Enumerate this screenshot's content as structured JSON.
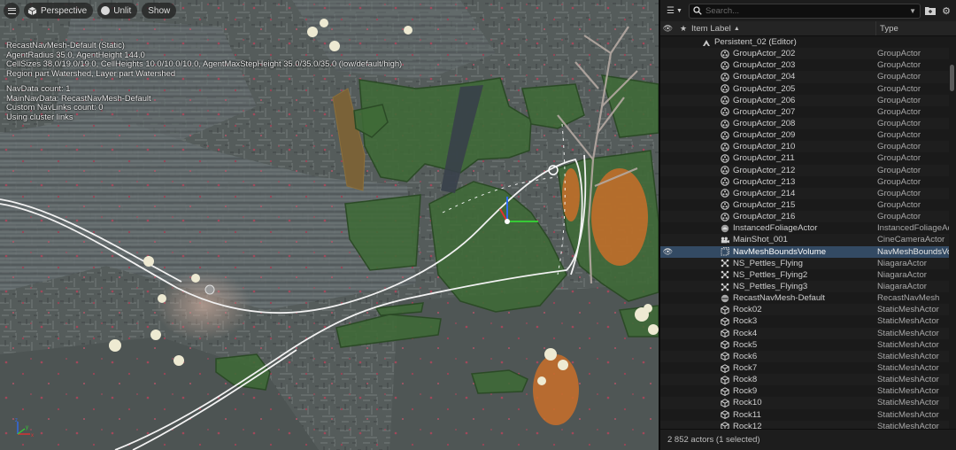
{
  "viewport": {
    "toolbar": {
      "menu_label": "",
      "perspective_label": "Perspective",
      "unlit_label": "Unlit",
      "show_label": "Show"
    },
    "stats_block1": [
      "RecastNavMesh-Default (Static)",
      "AgentRadius 35.0, AgentHeight 144.0",
      "CellSizes 38.0/19.0/19.0, CellHeights 10.0/10.0/10.0, AgentMaxStepHeight 35.0/35.0/35.0 (low/default/high)",
      "Region part Watershed, Layer part Watershed"
    ],
    "stats_block2": [
      "NavData count: 1",
      "MainNavData: RecastNavMesh-Default",
      "Custom NavLinks count: 0",
      "Using cluster links"
    ],
    "gizmo_labels": {
      "z": "z",
      "x": "x",
      "y": "y"
    }
  },
  "outliner": {
    "search_placeholder": "Search...",
    "header": {
      "label": "Item Label",
      "sort_indicator": "▲",
      "type": "Type"
    },
    "rows": [
      {
        "label": "Persistent_02 (Editor)",
        "type": "",
        "icon": "level-icon",
        "indent": 1,
        "visible": false,
        "selected": false
      },
      {
        "label": "GroupActor_202",
        "type": "GroupActor",
        "icon": "group-actor-icon",
        "indent": 2,
        "visible": false,
        "selected": false
      },
      {
        "label": "GroupActor_203",
        "type": "GroupActor",
        "icon": "group-actor-icon",
        "indent": 2,
        "visible": false,
        "selected": false
      },
      {
        "label": "GroupActor_204",
        "type": "GroupActor",
        "icon": "group-actor-icon",
        "indent": 2,
        "visible": false,
        "selected": false
      },
      {
        "label": "GroupActor_205",
        "type": "GroupActor",
        "icon": "group-actor-icon",
        "indent": 2,
        "visible": false,
        "selected": false
      },
      {
        "label": "GroupActor_206",
        "type": "GroupActor",
        "icon": "group-actor-icon",
        "indent": 2,
        "visible": false,
        "selected": false
      },
      {
        "label": "GroupActor_207",
        "type": "GroupActor",
        "icon": "group-actor-icon",
        "indent": 2,
        "visible": false,
        "selected": false
      },
      {
        "label": "GroupActor_208",
        "type": "GroupActor",
        "icon": "group-actor-icon",
        "indent": 2,
        "visible": false,
        "selected": false
      },
      {
        "label": "GroupActor_209",
        "type": "GroupActor",
        "icon": "group-actor-icon",
        "indent": 2,
        "visible": false,
        "selected": false
      },
      {
        "label": "GroupActor_210",
        "type": "GroupActor",
        "icon": "group-actor-icon",
        "indent": 2,
        "visible": false,
        "selected": false
      },
      {
        "label": "GroupActor_211",
        "type": "GroupActor",
        "icon": "group-actor-icon",
        "indent": 2,
        "visible": false,
        "selected": false
      },
      {
        "label": "GroupActor_212",
        "type": "GroupActor",
        "icon": "group-actor-icon",
        "indent": 2,
        "visible": false,
        "selected": false
      },
      {
        "label": "GroupActor_213",
        "type": "GroupActor",
        "icon": "group-actor-icon",
        "indent": 2,
        "visible": false,
        "selected": false
      },
      {
        "label": "GroupActor_214",
        "type": "GroupActor",
        "icon": "group-actor-icon",
        "indent": 2,
        "visible": false,
        "selected": false
      },
      {
        "label": "GroupActor_215",
        "type": "GroupActor",
        "icon": "group-actor-icon",
        "indent": 2,
        "visible": false,
        "selected": false
      },
      {
        "label": "GroupActor_216",
        "type": "GroupActor",
        "icon": "group-actor-icon",
        "indent": 2,
        "visible": false,
        "selected": false
      },
      {
        "label": "InstancedFoliageActor",
        "type": "InstancedFoliageActor",
        "icon": "foliage-actor-icon",
        "indent": 2,
        "visible": false,
        "selected": false
      },
      {
        "label": "MainShot_001",
        "type": "CineCameraActor",
        "icon": "camera-actor-icon",
        "indent": 2,
        "visible": false,
        "selected": false
      },
      {
        "label": "NavMeshBoundsVolume",
        "type": "NavMeshBoundsVolume",
        "icon": "volume-icon",
        "indent": 2,
        "visible": true,
        "selected": true
      },
      {
        "label": "NS_Pettles_Flying",
        "type": "NiagaraActor",
        "icon": "niagara-icon",
        "indent": 2,
        "visible": false,
        "selected": false
      },
      {
        "label": "NS_Pettles_Flying2",
        "type": "NiagaraActor",
        "icon": "niagara-icon",
        "indent": 2,
        "visible": false,
        "selected": false
      },
      {
        "label": "NS_Pettles_Flying3",
        "type": "NiagaraActor",
        "icon": "niagara-icon",
        "indent": 2,
        "visible": false,
        "selected": false
      },
      {
        "label": "RecastNavMesh-Default",
        "type": "RecastNavMesh",
        "icon": "navmesh-icon",
        "indent": 2,
        "visible": false,
        "selected": false
      },
      {
        "label": "Rock02",
        "type": "StaticMeshActor",
        "icon": "static-mesh-icon",
        "indent": 2,
        "visible": false,
        "selected": false
      },
      {
        "label": "Rock3",
        "type": "StaticMeshActor",
        "icon": "static-mesh-icon",
        "indent": 2,
        "visible": false,
        "selected": false
      },
      {
        "label": "Rock4",
        "type": "StaticMeshActor",
        "icon": "static-mesh-icon",
        "indent": 2,
        "visible": false,
        "selected": false
      },
      {
        "label": "Rock5",
        "type": "StaticMeshActor",
        "icon": "static-mesh-icon",
        "indent": 2,
        "visible": false,
        "selected": false
      },
      {
        "label": "Rock6",
        "type": "StaticMeshActor",
        "icon": "static-mesh-icon",
        "indent": 2,
        "visible": false,
        "selected": false
      },
      {
        "label": "Rock7",
        "type": "StaticMeshActor",
        "icon": "static-mesh-icon",
        "indent": 2,
        "visible": false,
        "selected": false
      },
      {
        "label": "Rock8",
        "type": "StaticMeshActor",
        "icon": "static-mesh-icon",
        "indent": 2,
        "visible": false,
        "selected": false
      },
      {
        "label": "Rock9",
        "type": "StaticMeshActor",
        "icon": "static-mesh-icon",
        "indent": 2,
        "visible": false,
        "selected": false
      },
      {
        "label": "Rock10",
        "type": "StaticMeshActor",
        "icon": "static-mesh-icon",
        "indent": 2,
        "visible": false,
        "selected": false
      },
      {
        "label": "Rock11",
        "type": "StaticMeshActor",
        "icon": "static-mesh-icon",
        "indent": 2,
        "visible": false,
        "selected": false
      },
      {
        "label": "Rock12",
        "type": "StaticMeshActor",
        "icon": "static-mesh-icon",
        "indent": 2,
        "visible": false,
        "selected": false
      }
    ],
    "footer": "2 852 actors (1 selected)"
  },
  "colors": {
    "selection": "#334a63",
    "navmesh_green": "#3f6a37",
    "panel_bg": "#1a1a1a"
  }
}
